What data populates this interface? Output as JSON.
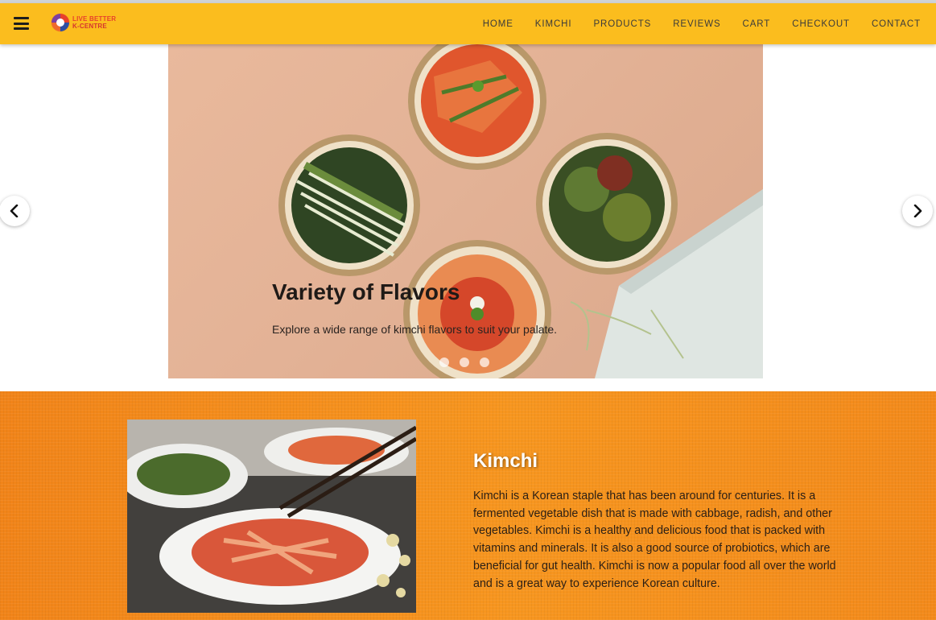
{
  "brand": {
    "logo_line1": "LIVE BETTER",
    "logo_line2": "K-CENTRE"
  },
  "nav": {
    "menu_icon": "hamburger-menu-icon",
    "links": [
      "HOME",
      "KIMCHI",
      "PRODUCTS",
      "REVIEWS",
      "CART",
      "CHECKOUT",
      "CONTACT"
    ]
  },
  "carousel": {
    "slide_title": "Variety of Flavors",
    "slide_text": "Explore a wide range of kimchi flavors to suit your palate.",
    "indicator_count": 3,
    "prev_icon": "chevron-left-icon",
    "next_icon": "chevron-right-icon"
  },
  "about": {
    "title": "Kimchi",
    "body": "Kimchi is a Korean staple that has been around for centuries. It is a fermented vegetable dish that is made with cabbage, radish, and other vegetables. Kimchi is a healthy and delicious food that is packed with vitamins and minerals. It is also a good source of probiotics, which are beneficial for gut health. Kimchi is now a popular food all over the world and is a great way to experience Korean culture."
  },
  "colors": {
    "navbar": "#fbbd1e",
    "about_bg": "#f58c1c"
  }
}
